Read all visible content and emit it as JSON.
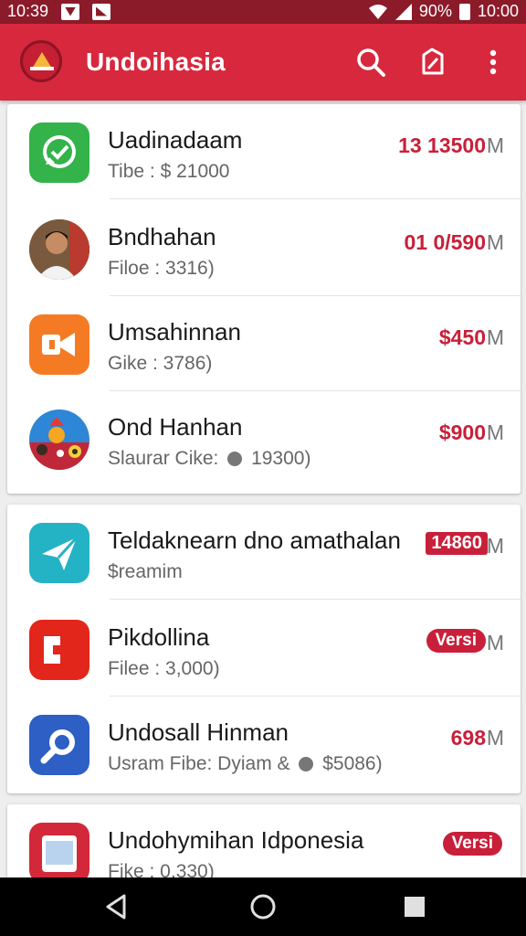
{
  "status": {
    "time_left": "10:39",
    "battery_text": "90%",
    "time_right": "10:00"
  },
  "appbar": {
    "title": "Undoihasia"
  },
  "colors": {
    "primary": "#d7283d",
    "status": "#8c1b2a",
    "price": "#c8203a"
  },
  "card1": {
    "items": [
      {
        "name": "Uadinadaam",
        "sub": "Tibe : $ 21000",
        "price": "13 13500",
        "unit": "M",
        "icon": "whatsapp-green-icon"
      },
      {
        "name": "Bndhahan",
        "sub": "Filoe : 3316)",
        "price": "01 0/590",
        "unit": "M",
        "icon": "person-avatar"
      },
      {
        "name": "Umsahinnan",
        "sub": "Gike : 3786)",
        "price": "$450",
        "unit": "M",
        "icon": "video-orange-icon"
      },
      {
        "name": "Ond Hanhan",
        "sub_pre": "Slaurar Cike:",
        "sub_post": "19300)",
        "price": "$900",
        "unit": "M",
        "icon": "festival-circle-icon"
      }
    ]
  },
  "card2": {
    "items": [
      {
        "name": "Teldaknearn dno amathalan",
        "sub": "$reamim",
        "badge": "14860",
        "unit": "M",
        "icon": "send-teal-icon"
      },
      {
        "name": "Pikdollina",
        "sub": "Filee : 3,000)",
        "badge": "Versi",
        "unit": "M",
        "icon": "slides-red-icon"
      },
      {
        "name": "Undosall Hinman",
        "sub_pre": "Usram Fibe: Dyiam &",
        "sub_post": "$5086)",
        "price": "698",
        "unit": "M",
        "icon": "link-blue-icon"
      }
    ]
  },
  "card3": {
    "items": [
      {
        "name": "Undohymihan Idponesia",
        "sub": "Fike : 0,330)",
        "badge": "Versi",
        "icon": "tablet-red-icon"
      }
    ]
  }
}
